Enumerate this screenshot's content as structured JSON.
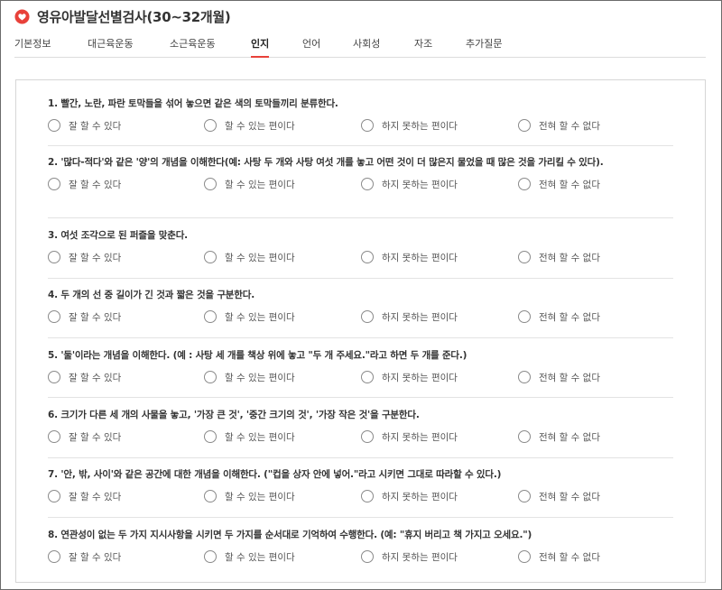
{
  "header": {
    "title": "영유아발달선별검사(30~32개월)"
  },
  "tabs": [
    {
      "label": "기본정보",
      "active": false
    },
    {
      "label": "대근육운동",
      "active": false
    },
    {
      "label": "소근육운동",
      "active": false
    },
    {
      "label": "인지",
      "active": true
    },
    {
      "label": "언어",
      "active": false
    },
    {
      "label": "사회성",
      "active": false
    },
    {
      "label": "자조",
      "active": false
    },
    {
      "label": "추가질문",
      "active": false
    }
  ],
  "options": [
    "잘 할 수 있다",
    "할 수 있는 편이다",
    "하지 못하는 편이다",
    "전혀 할 수 없다"
  ],
  "questions": [
    {
      "text": "1. 빨간, 노란, 파란 토막들을 섞어 놓으면 같은 색의 토막들끼리 분류한다."
    },
    {
      "text": "2. '많다-적다'와 같은 '양'의 개념을 이해한다(예: 사탕 두 개와 사탕 여섯 개를 놓고 어떤 것이 더 많은지 물었을 때 많은 것을 가리킬 수 있다)."
    },
    {
      "text": "3. 여섯 조각으로 된 퍼즐을 맞춘다."
    },
    {
      "text": "4. 두 개의 선 중 길이가 긴 것과 짧은 것을 구분한다."
    },
    {
      "text": "5. '둘'이라는 개념을 이해한다. (예 : 사탕 세 개를 책상 위에 놓고 \"두 개 주세요.\"라고 하면 두 개를 준다.)"
    },
    {
      "text": "6. 크기가 다른 세 개의 사물을 놓고, '가장 큰 것', '중간 크기의 것', '가장 작은 것'을 구분한다."
    },
    {
      "text": "7. '안, 밖, 사이'와 같은 공간에 대한 개념을 이해한다. (\"컵을 상자 안에 넣어.\"라고 시키면 그대로 따라할 수 있다.)"
    },
    {
      "text": "8. 연관성이 없는 두 가지 지시사항을 시키면 두 가지를 순서대로 기억하여 수행한다. (예: \"휴지 버리고 책 가지고 오세요.\")"
    }
  ],
  "colors": {
    "accent": "#e8413a",
    "border": "#d6d6d6",
    "divider": "#e3e3e3"
  }
}
